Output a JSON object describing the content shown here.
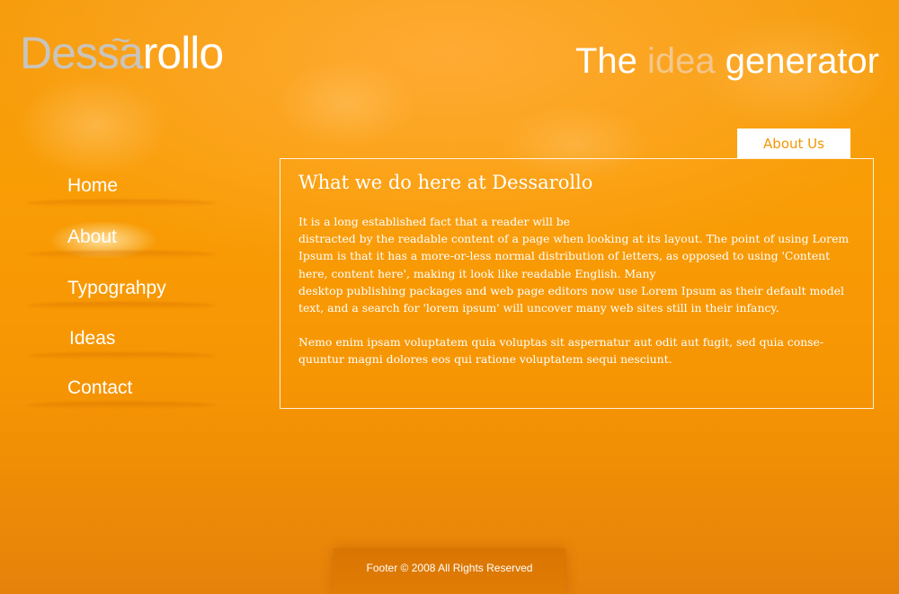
{
  "header": {
    "logo_part1": "Des",
    "logo_tilde": "~",
    "logo_part2": "sa",
    "logo_part3": "rollo",
    "tagline_pre": "The ",
    "tagline_highlight": "idea",
    "tagline_post": " generator"
  },
  "nav": {
    "items": [
      {
        "label": "Home"
      },
      {
        "label": "About"
      },
      {
        "label": "Typograhpy"
      },
      {
        "label": "Ideas"
      },
      {
        "label": "Contact"
      }
    ],
    "active": "About"
  },
  "tab": {
    "label": "About Us"
  },
  "content": {
    "heading": "What we do here at Dessarollo",
    "paragraph1_line1": "It is a long established fact that a reader will be",
    "paragraph1_rest": "distracted by the readable content of a page when looking at its layout. The point of using Lorem Ipsum is that it has a more-or-less normal distribution of letters, as opposed to using 'Content here, content here', making it look like readable English. Many",
    "paragraph1_line_last": "desktop publishing packages and web page editors now use Lorem Ipsum as their default model text, and a search for 'lorem ipsum' will uncover many web sites still in their infancy.",
    "paragraph2": "Nemo enim ipsam voluptatem quia voluptas sit aspernatur aut odit aut fugit, sed quia conse-quuntur magni dolores eos qui ratione voluptatem sequi nesciunt."
  },
  "footer": {
    "text": "Footer © 2008 All Rights Reserved"
  },
  "colors": {
    "background": "#f99d05",
    "logo_gray": "#c9c4bd",
    "highlight": "#f3c78a",
    "tab_text": "#f39600"
  }
}
